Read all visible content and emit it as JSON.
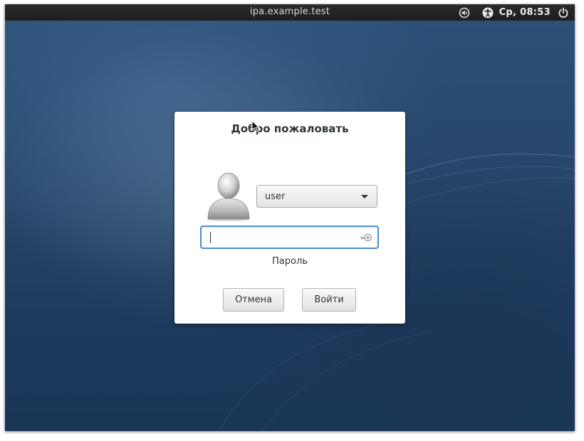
{
  "topbar": {
    "hostname": "ipa.example.test",
    "clock": "Ср, 08:53",
    "icons": [
      "sound-icon",
      "accessibility-icon",
      "power-icon"
    ]
  },
  "dialog": {
    "title": "Добро пожаловать",
    "user_select": {
      "value": "user"
    },
    "password_field": {
      "value": "",
      "label": "Пароль"
    },
    "buttons": {
      "cancel": "Отмена",
      "login": "Войти"
    }
  },
  "colors": {
    "focus_accent": "#4a90d9",
    "topbar_bg": "#1e1e1e",
    "wallpaper": "#254568"
  }
}
